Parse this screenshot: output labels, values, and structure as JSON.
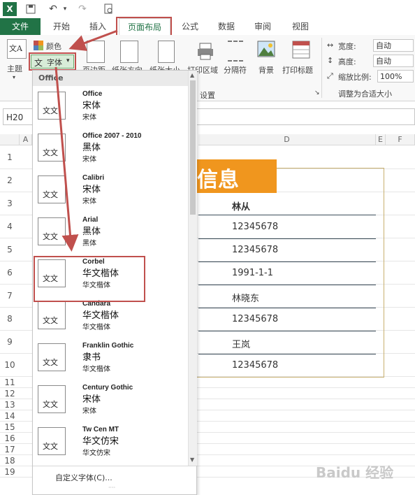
{
  "quick_access": {
    "app_icon": "X",
    "undo_icon": "↶",
    "redo_icon": "↷"
  },
  "tabs": [
    "文件",
    "开始",
    "插入",
    "页面布局",
    "公式",
    "数据",
    "审阅",
    "视图"
  ],
  "ribbon": {
    "themes_label": "主题",
    "colors_label": "颜色",
    "fonts_label": "字体",
    "margins_label": "页边距",
    "orientation_label": "纸张方向",
    "size_label": "纸张大小",
    "print_area_label": "打印区域",
    "breaks_label": "分隔符",
    "background_label": "背景",
    "print_titles_label": "打印标题",
    "page_setup_group": "设置",
    "width_label": "宽度:",
    "width_value": "自动",
    "height_label": "高度:",
    "height_value": "自动",
    "scale_label": "缩放比例:",
    "scale_value": "100%",
    "scale_group": "调整为合适大小"
  },
  "name_box": "H20",
  "columns": [
    "A",
    "D",
    "E",
    "F"
  ],
  "rows": [
    "1",
    "2",
    "3",
    "4",
    "5",
    "6",
    "7",
    "8",
    "9",
    "10",
    "11",
    "12",
    "13",
    "14",
    "15",
    "16",
    "17",
    "18",
    "19"
  ],
  "sheet": {
    "banner_text": "信息",
    "header": "林从",
    "values": [
      "12345678",
      "12345678",
      "1991-1-1",
      "林晓东",
      "12345678",
      "王岚",
      "12345678"
    ]
  },
  "dropdown": {
    "section_title": "Office",
    "themes": [
      {
        "name": "Office",
        "major": "宋体",
        "minor": "宋体"
      },
      {
        "name": "Office 2007 - 2010",
        "major": "黑体",
        "minor": "宋体"
      },
      {
        "name": "Calibri",
        "major": "宋体",
        "minor": "宋体"
      },
      {
        "name": "Arial",
        "major": "黑体",
        "minor": "黑体"
      },
      {
        "name": "Corbel",
        "major": "华文楷体",
        "minor": "华文楷体"
      },
      {
        "name": "Candara",
        "major": "华文楷体",
        "minor": "华文楷体"
      },
      {
        "name": "Franklin Gothic",
        "major": "隶书",
        "minor": "华文楷体"
      },
      {
        "name": "Century Gothic",
        "major": "宋体",
        "minor": "宋体"
      },
      {
        "name": "Tw Cen MT",
        "major": "华文仿宋",
        "minor": "华文仿宋"
      }
    ],
    "thumb_text": "文文",
    "custom_fonts": "自定义字体(C)..."
  },
  "watermark": "Baidu 经验",
  "colors": {
    "excel_green": "#217346",
    "highlight_red": "#c0504d",
    "banner_orange": "#f0961e"
  }
}
